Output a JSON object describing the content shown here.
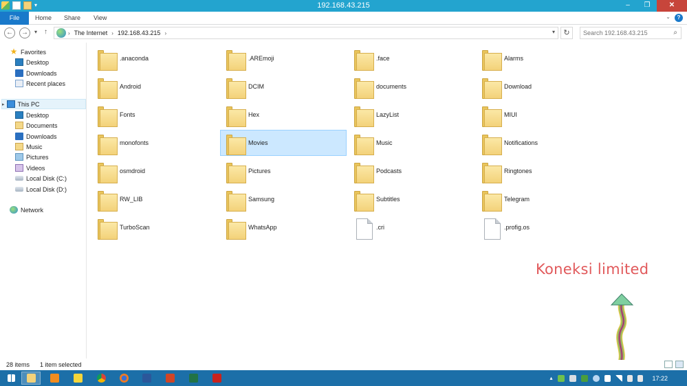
{
  "window": {
    "title": "192.168.43.215"
  },
  "quick_access": [
    "system-icon",
    "properties-icon",
    "new-folder-icon"
  ],
  "ribbon": {
    "tabs": [
      "File",
      "Home",
      "Share",
      "View"
    ]
  },
  "address": {
    "segments": [
      "The Internet",
      "192.168.43.215"
    ],
    "search_placeholder": "Search 192.168.43.215"
  },
  "sidebar": {
    "favorites": {
      "label": "Favorites",
      "items": [
        "Desktop",
        "Downloads",
        "Recent places"
      ]
    },
    "this_pc": {
      "label": "This PC",
      "items": [
        "Desktop",
        "Documents",
        "Downloads",
        "Music",
        "Pictures",
        "Videos",
        "Local Disk (C:)",
        "Local Disk (D:)"
      ]
    },
    "network": {
      "label": "Network"
    }
  },
  "files": [
    {
      "name": ".anaconda",
      "type": "folder"
    },
    {
      "name": ".AREmoji",
      "type": "folder"
    },
    {
      "name": ".face",
      "type": "folder"
    },
    {
      "name": "Alarms",
      "type": "folder"
    },
    {
      "name": "Android",
      "type": "folder"
    },
    {
      "name": "DCIM",
      "type": "folder"
    },
    {
      "name": "documents",
      "type": "folder"
    },
    {
      "name": "Download",
      "type": "folder"
    },
    {
      "name": "Fonts",
      "type": "folder"
    },
    {
      "name": "Hex",
      "type": "folder"
    },
    {
      "name": "LazyList",
      "type": "folder"
    },
    {
      "name": "MIUI",
      "type": "folder"
    },
    {
      "name": "monofonts",
      "type": "folder"
    },
    {
      "name": "Movies",
      "type": "folder",
      "selected": true
    },
    {
      "name": "Music",
      "type": "folder"
    },
    {
      "name": "Notifications",
      "type": "folder"
    },
    {
      "name": "osmdroid",
      "type": "folder"
    },
    {
      "name": "Pictures",
      "type": "folder"
    },
    {
      "name": "Podcasts",
      "type": "folder"
    },
    {
      "name": "Ringtones",
      "type": "folder"
    },
    {
      "name": "RW_LIB",
      "type": "folder"
    },
    {
      "name": "Samsung",
      "type": "folder"
    },
    {
      "name": "Subtitles",
      "type": "folder"
    },
    {
      "name": "Telegram",
      "type": "folder"
    },
    {
      "name": "TurboScan",
      "type": "folder"
    },
    {
      "name": "WhatsApp",
      "type": "folder"
    },
    {
      "name": ".cri",
      "type": "file"
    },
    {
      "name": ".profig.os",
      "type": "file"
    }
  ],
  "annotation": {
    "text": "Koneksi limited",
    "color": "#e1595b"
  },
  "status": {
    "count": "28 items",
    "selection": "1 item selected"
  },
  "taskbar": {
    "apps": [
      "explorer-icon",
      "media-player-icon",
      "slideshow-icon",
      "chrome-icon",
      "firefox-icon",
      "word-icon",
      "powerpoint-icon",
      "excel-icon",
      "pdf-icon"
    ],
    "clock": "17:22"
  },
  "colors": {
    "titlebar": "#23a4cf",
    "file_tab": "#1979ca",
    "selection": "#cce8ff",
    "taskbar": "#1c6fa8"
  }
}
